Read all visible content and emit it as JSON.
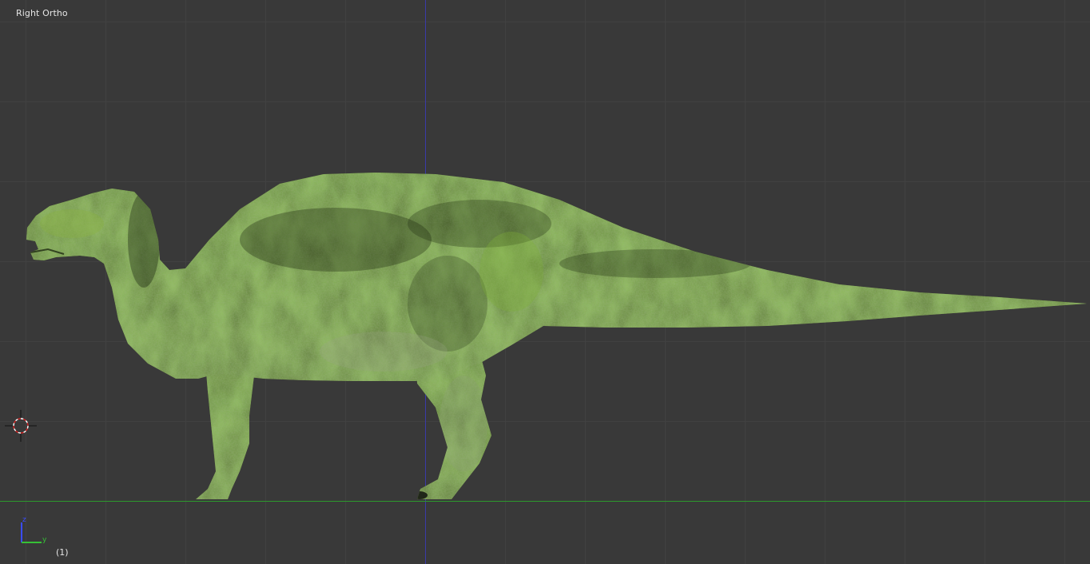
{
  "viewport": {
    "view_name": "Right Ortho",
    "frame_indicator": "(1)",
    "background_color": "#393939",
    "grid_color": "#414141",
    "z_axis_line_color": "#3a3aa8",
    "y_axis_line_color": "#2d9a2d"
  },
  "axis_gizmo": {
    "vertical_axis_label": "z",
    "horizontal_axis_label": "y",
    "vertical_axis_color": "#3a4cff",
    "horizontal_axis_color": "#36c036"
  },
  "scene": {
    "object": "dinosaur-model",
    "texture_colors": [
      "#5b7a2c",
      "#3c5520",
      "#7da23a",
      "#8a9a6a",
      "#2a3a18"
    ]
  },
  "icons": {
    "cursor": "3d-cursor-icon",
    "gizmo": "axis-gizmo-icon"
  }
}
